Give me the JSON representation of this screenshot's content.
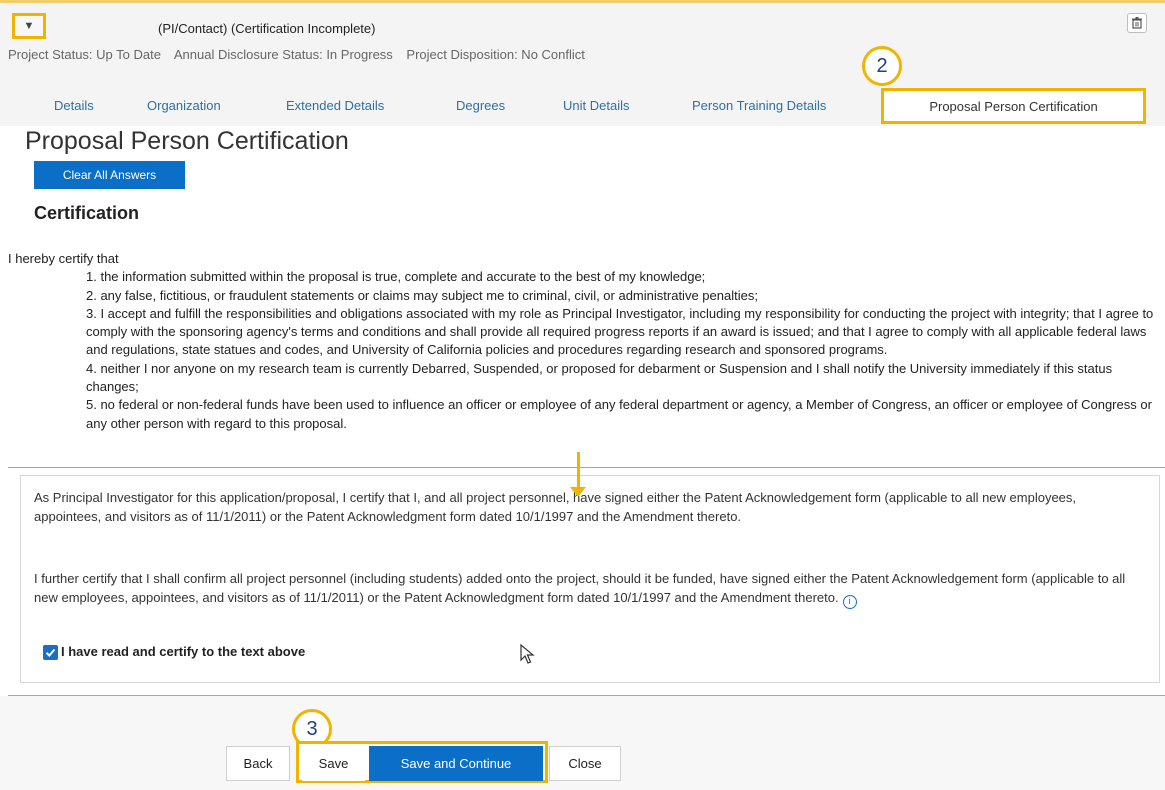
{
  "header": {
    "person_title": "(PI/Contact) (Certification Incomplete)",
    "project_status": "Project Status: Up To Date",
    "disclosure_status": "Annual Disclosure Status: In Progress",
    "project_disposition": "Project Disposition: No Conflict"
  },
  "tabs": {
    "details": "Details",
    "organization": "Organization",
    "extended_details": "Extended Details",
    "degrees": "Degrees",
    "unit_details": "Unit Details",
    "person_training_details": "Person Training Details",
    "proposal_person_certification": "Proposal Person Certification"
  },
  "callouts": {
    "two": "2",
    "three": "3"
  },
  "section": {
    "title": "Proposal Person Certification",
    "clear_all_label": "Clear All Answers",
    "certification_heading": "Certification"
  },
  "certification": {
    "intro": "I hereby certify that",
    "items": [
      "1. the information submitted within the proposal is true, complete and accurate to the best of my knowledge;",
      "2. any false, fictitious, or fraudulent statements or claims may subject me to criminal, civil, or administrative penalties;",
      "3. I accept and fulfill the responsibilities and obligations associated with my role as Principal Investigator, including my responsibility for conducting the project with integrity; that I agree to comply with the sponsoring agency's terms and conditions and shall provide all required progress reports if an award is issued; and that I agree to comply with all applicable federal laws and regulations, state statues and codes, and University of California policies and procedures regarding research and sponsored programs.",
      "4. neither I nor anyone on my research team is currently Debarred, Suspended, or proposed for debarment or Suspension and I shall notify the University immediately if this status changes;",
      "5. no federal or non-federal funds have been used to influence an officer or employee of any federal department or agency, a Member of Congress, an officer or employee of Congress or any other person with regard to this proposal."
    ]
  },
  "patent": {
    "paragraph1": "As Principal Investigator for this application/proposal, I certify that I, and all project personnel, have signed either the Patent Acknowledgement form (applicable to all new employees, appointees, and visitors as of 11/1/2011) or the Patent Acknowledgment form dated 10/1/1997 and the Amendment thereto.",
    "paragraph2": "I further certify that I shall confirm all project personnel (including students) added onto the project, should it be funded, have signed either the Patent Acknowledgement form (applicable to all new employees, appointees, and visitors as of 11/1/2011) or the Patent Acknowledgment form dated 10/1/1997 and the Amendment thereto.",
    "info_glyph": "i",
    "checkbox_label": "I have read and certify to the text above",
    "checkbox_checked": true
  },
  "buttons": {
    "back": "Back",
    "save": "Save",
    "save_and_continue": "Save and Continue",
    "close": "Close"
  },
  "colors": {
    "highlight": "#f0b400",
    "primary_button": "#0b6fc7",
    "tab_link": "#2f6fa3"
  }
}
